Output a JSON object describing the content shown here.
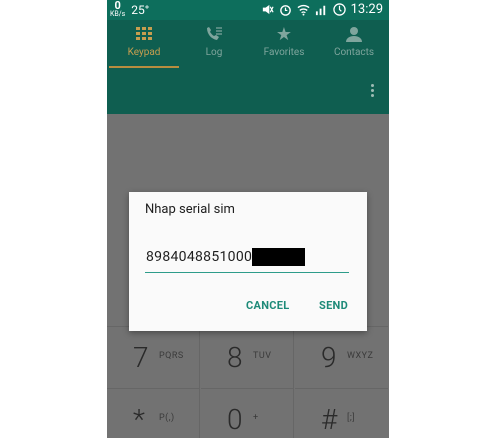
{
  "status_bar": {
    "speed_value": "0",
    "speed_unit": "KB/s",
    "temperature": "25°",
    "time": "13:29"
  },
  "tabs": [
    {
      "label": "Keypad",
      "icon": "keypad-icon",
      "active": true
    },
    {
      "label": "Log",
      "icon": "log-icon",
      "active": false
    },
    {
      "label": "Favorites",
      "icon": "star-icon",
      "active": false
    },
    {
      "label": "Contacts",
      "icon": "contact-icon",
      "active": false
    }
  ],
  "dialpad": {
    "keys": [
      {
        "digit": "7",
        "letters": "PQRS"
      },
      {
        "digit": "8",
        "letters": "TUV"
      },
      {
        "digit": "9",
        "letters": "WXYZ"
      },
      {
        "digit": "*",
        "letters": "P(,)"
      },
      {
        "digit": "0",
        "letters": "+"
      },
      {
        "digit": "#",
        "letters": "[;]"
      }
    ]
  },
  "dialog": {
    "title": "Nhap serial sim",
    "input_value": "8984048851000",
    "cancel_label": "CANCEL",
    "send_label": "SEND"
  },
  "colors": {
    "teal_header": "#0f5e50",
    "accent": "#1d8a78",
    "tab_active": "#c79e4f"
  }
}
